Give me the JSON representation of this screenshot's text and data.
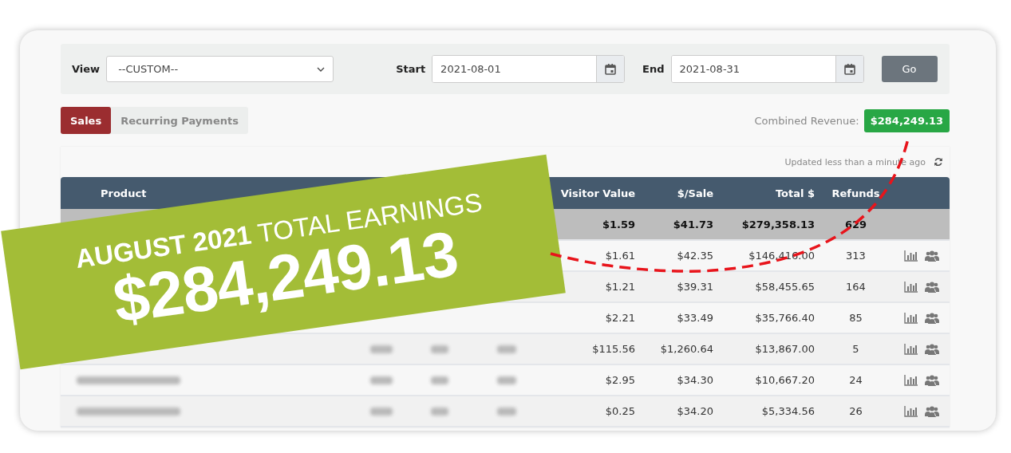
{
  "filters": {
    "view_label": "View",
    "view_value": "--CUSTOM--",
    "start_label": "Start",
    "start_value": "2021-08-01",
    "end_label": "End",
    "end_value": "2021-08-31",
    "go": "Go"
  },
  "tabs": [
    {
      "label": "Sales",
      "selected": true
    },
    {
      "label": "Recurring Payments",
      "selected": false
    }
  ],
  "combined_revenue": {
    "label": "Combined Revenue:",
    "value": "$284,249.13"
  },
  "updated": "Updated less than a minute ago",
  "table": {
    "columns": [
      "Product",
      "Visitor Value",
      "$/Sale",
      "Total $",
      "Refunds"
    ],
    "total_row": {
      "visitor_value": "$1.59",
      "per_sale": "$41.73",
      "total": "$279,358.13",
      "refunds": "629"
    },
    "rows": [
      {
        "visitor_value": "$1.61",
        "per_sale": "$42.35",
        "total": "$146,416.00",
        "refunds": "313"
      },
      {
        "visitor_value": "$1.21",
        "per_sale": "$39.31",
        "total": "$58,455.65",
        "refunds": "164"
      },
      {
        "visitor_value": "$2.21",
        "per_sale": "$33.49",
        "total": "$35,766.40",
        "refunds": "85"
      },
      {
        "visitor_value": "$115.56",
        "per_sale": "$1,260.64",
        "total": "$13,867.00",
        "refunds": "5"
      },
      {
        "visitor_value": "$2.95",
        "per_sale": "$34.30",
        "total": "$10,667.20",
        "refunds": "24"
      },
      {
        "visitor_value": "$0.25",
        "per_sale": "$34.20",
        "total": "$5,334.56",
        "refunds": "26"
      }
    ]
  },
  "banner": {
    "headline": "**AUGUST 2021** TOTAL EARNINGS",
    "amount": "$284,249.13"
  }
}
